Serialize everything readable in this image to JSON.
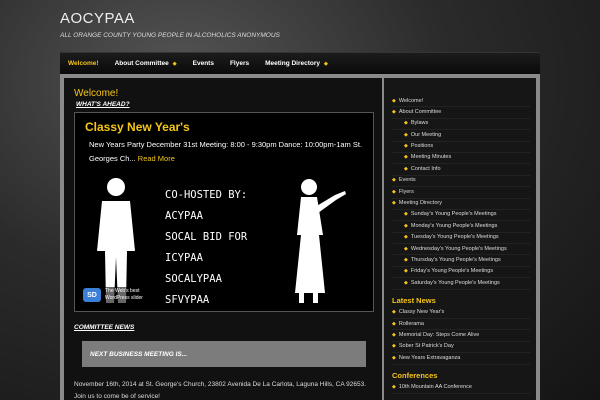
{
  "site": {
    "title": "AOCYPAA",
    "tagline": "ALL ORANGE COUNTY YOUNG PEOPLE IN ALCOHOLICS ANONYMOUS"
  },
  "nav": {
    "items": [
      {
        "label": "Welcome!",
        "active": true,
        "dropdown": false
      },
      {
        "label": "About Committee",
        "active": false,
        "dropdown": true
      },
      {
        "label": "Events",
        "active": false,
        "dropdown": false
      },
      {
        "label": "Flyers",
        "active": false,
        "dropdown": false
      },
      {
        "label": "Meeting Directory",
        "active": false,
        "dropdown": true
      }
    ]
  },
  "main": {
    "page_title": "Welcome!",
    "whats_ahead": "WHAT'S AHEAD?",
    "slide": {
      "title": "Classy New Year's",
      "text": "New Years Party December 31st Meeting: 8:00 - 9:30pm Dance: 10:00pm-1am St. Georges Ch...",
      "read_more": "Read More",
      "flyer_lines": [
        "CO-HOSTED BY:",
        "ACYPAA",
        "SOCAL BID FOR",
        "ICYPAA",
        "SOCALYPAA",
        "SFVYPAA"
      ]
    },
    "slider_badge": {
      "logo": "SD",
      "line1": "The Web's best",
      "line2": "WordPress slider"
    },
    "committee_news": "COMMITTEE NEWS",
    "meeting_box": "NEXT BUSINESS MEETING IS...",
    "meeting_info_1": "November 16th, 2014 at St. George's Church, 23802 Avenida De La Carlota, Laguna Hills, CA 92653.",
    "meeting_info_2": "Join us to come be of service!"
  },
  "sidebar": {
    "menu": [
      {
        "label": "Welcome!",
        "sub": false
      },
      {
        "label": "About Committee",
        "sub": false
      },
      {
        "label": "Bylaws",
        "sub": true
      },
      {
        "label": "Our Meeting",
        "sub": true
      },
      {
        "label": "Positions",
        "sub": true
      },
      {
        "label": "Meeting Minutes",
        "sub": true
      },
      {
        "label": "Contact Info",
        "sub": true
      },
      {
        "label": "Events",
        "sub": false
      },
      {
        "label": "Flyers",
        "sub": false
      },
      {
        "label": "Meeting Directory",
        "sub": false
      },
      {
        "label": "Sunday's Young People's Meetings",
        "sub": true
      },
      {
        "label": "Monday's Young People's Meetings",
        "sub": true
      },
      {
        "label": "Tuesday's Young People's Meetings",
        "sub": true
      },
      {
        "label": "Wednesday's Young People's Meetings",
        "sub": true
      },
      {
        "label": "Thursday's Young People's Meetings",
        "sub": true
      },
      {
        "label": "Friday's Young People's Meetings",
        "sub": true
      },
      {
        "label": "Saturday's Young People's Meetings",
        "sub": true
      }
    ],
    "latest_news_heading": "Latest News",
    "latest_news": [
      "Classy New Year's",
      "Rollerama",
      "Memorial Day: Steps Come Alive",
      "Sober St Patrick's Day",
      "New Years Extravaganza"
    ],
    "conferences_heading": "Conferences",
    "conferences": [
      "10th Mountain AA Conference"
    ]
  },
  "colors": {
    "accent": "#f5c518",
    "frame": "#8a8a8a",
    "content_bg": "#111111"
  }
}
